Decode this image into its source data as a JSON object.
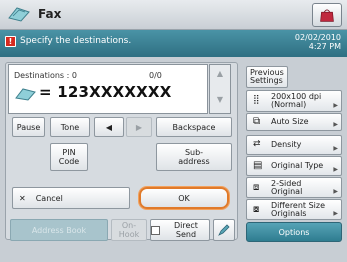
{
  "title": "Fax",
  "message": "Specify the destinations.",
  "datetime": {
    "date": "02/02/2010",
    "time": "4:27 PM"
  },
  "destinations": {
    "label": "Destinations : 0",
    "counter": "0/0",
    "number": "= 123XXXXXXX"
  },
  "keys": {
    "pause": "Pause",
    "tone": "Tone",
    "backspace": "Backspace",
    "pin_code_line1": "PIN",
    "pin_code_line2": "Code",
    "subaddress_line1": "Sub-",
    "subaddress_line2": "address",
    "cancel": "Cancel",
    "ok": "OK"
  },
  "bottom": {
    "address_book": "Address Book",
    "on_hook": "On-Hook",
    "direct_send": "Direct Send"
  },
  "right": {
    "previous_settings": "Previous Settings",
    "resolution_line1": "200x100 dpi",
    "resolution_line2": "(Normal)",
    "auto_size": "Auto Size",
    "density": "Density",
    "original_type": "Original Type",
    "two_sided_line1": "2-Sided",
    "two_sided_line2": "Original",
    "diff_size_line1": "Different Size",
    "diff_size_line2": "Originals",
    "options": "Options"
  },
  "colors": {
    "accent_teal": "#2f7d90",
    "ok_highlight": "#e07a2a",
    "warning_red": "#d62a1f"
  }
}
